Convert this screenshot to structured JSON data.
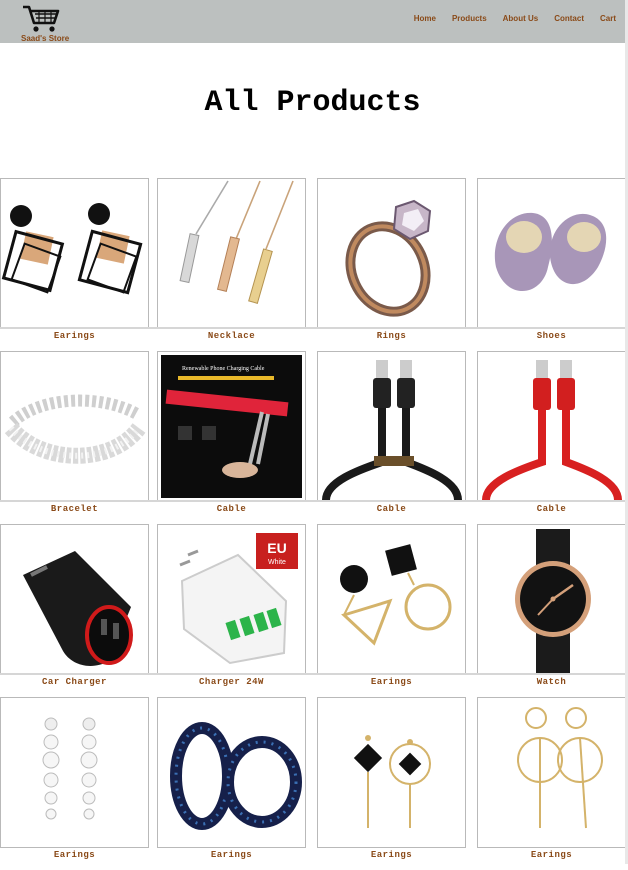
{
  "store": {
    "name": "Saad's Store",
    "logo_icon": "shopping-cart-icon"
  },
  "nav": {
    "items": [
      "Home",
      "Products",
      "About Us",
      "Contact",
      "Cart"
    ]
  },
  "page": {
    "title": "All Products"
  },
  "colors": {
    "navbar": "#bcc0bf",
    "accent": "#8a4a18",
    "card_border": "#b9b9b9"
  },
  "products": [
    {
      "label": "Earings",
      "icon": "earrings-square-icon"
    },
    {
      "label": "Necklace",
      "icon": "necklace-bar-icon"
    },
    {
      "label": "Rings",
      "icon": "ring-icon"
    },
    {
      "label": "Shoes",
      "icon": "slippers-icon"
    },
    {
      "label": "Bracelet",
      "icon": "bracelet-icon"
    },
    {
      "label": "Cable",
      "icon": "cable-cutting-demo-icon"
    },
    {
      "label": "Cable",
      "icon": "black-usb-cable-icon"
    },
    {
      "label": "Cable",
      "icon": "red-usb-cable-icon"
    },
    {
      "label": "Car Charger",
      "icon": "car-charger-icon"
    },
    {
      "label": "Charger 24W",
      "icon": "wall-charger-icon"
    },
    {
      "label": "Earings",
      "icon": "earrings-geometric-icon"
    },
    {
      "label": "Watch",
      "icon": "watch-icon"
    },
    {
      "label": "Earings",
      "icon": "pearl-earrings-icon"
    },
    {
      "label": "Earings",
      "icon": "hoop-earrings-icon"
    },
    {
      "label": "Earings",
      "icon": "diamond-drop-earrings-icon"
    },
    {
      "label": "Earings",
      "icon": "circle-drop-earrings-icon"
    }
  ],
  "charger_badge": {
    "line1": "EU",
    "line2": "White"
  },
  "cable_demo_caption": "Renewable Phone Charging Cable"
}
